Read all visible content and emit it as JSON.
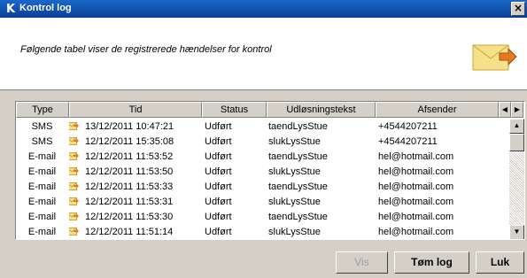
{
  "window": {
    "logo": "K",
    "title": "Kontrol log",
    "close": "×"
  },
  "header": {
    "description": "Følgende tabel viser de registrerede hændelser for kontrol"
  },
  "table": {
    "columns": [
      "Type",
      "Tid",
      "Status",
      "Udløsningstekst",
      "Afsender"
    ],
    "scroll_left": "◀",
    "scroll_right": "▶",
    "rows": [
      {
        "type": "SMS",
        "tid": "13/12/2011 10:47:21",
        "status": "Udført",
        "trigger": "taendLysStue",
        "sender": "+4544207211"
      },
      {
        "type": "SMS",
        "tid": "12/12/2011 15:35:08",
        "status": "Udført",
        "trigger": "slukLysStue",
        "sender": "+4544207211"
      },
      {
        "type": "E-mail",
        "tid": "12/12/2011 11:53:52",
        "status": "Udført",
        "trigger": "taendLysStue",
        "sender": "hel@hotmail.com"
      },
      {
        "type": "E-mail",
        "tid": "12/12/2011 11:53:50",
        "status": "Udført",
        "trigger": "slukLysStue",
        "sender": "hel@hotmail.com"
      },
      {
        "type": "E-mail",
        "tid": "12/12/2011 11:53:33",
        "status": "Udført",
        "trigger": "taendLysStue",
        "sender": "hel@hotmail.com"
      },
      {
        "type": "E-mail",
        "tid": "12/12/2011 11:53:31",
        "status": "Udført",
        "trigger": "slukLysStue",
        "sender": "hel@hotmail.com"
      },
      {
        "type": "E-mail",
        "tid": "12/12/2011 11:53:30",
        "status": "Udført",
        "trigger": "taendLysStue",
        "sender": "hel@hotmail.com"
      },
      {
        "type": "E-mail",
        "tid": "12/12/2011 11:51:14",
        "status": "Udført",
        "trigger": "slukLysStue",
        "sender": "hel@hotmail.com"
      }
    ]
  },
  "scrollbar": {
    "up": "▲",
    "down": "▼"
  },
  "buttons": {
    "view": "Vis",
    "clear": "Tøm log",
    "close": "Luk"
  },
  "icons": {
    "row_icon": "envelope-arrow-icon",
    "header_icon": "envelope-arrow-icon"
  },
  "colors": {
    "titlebar": "#0a3e96",
    "envelope": "#f4d35e",
    "arrow": "#e07b1f"
  }
}
